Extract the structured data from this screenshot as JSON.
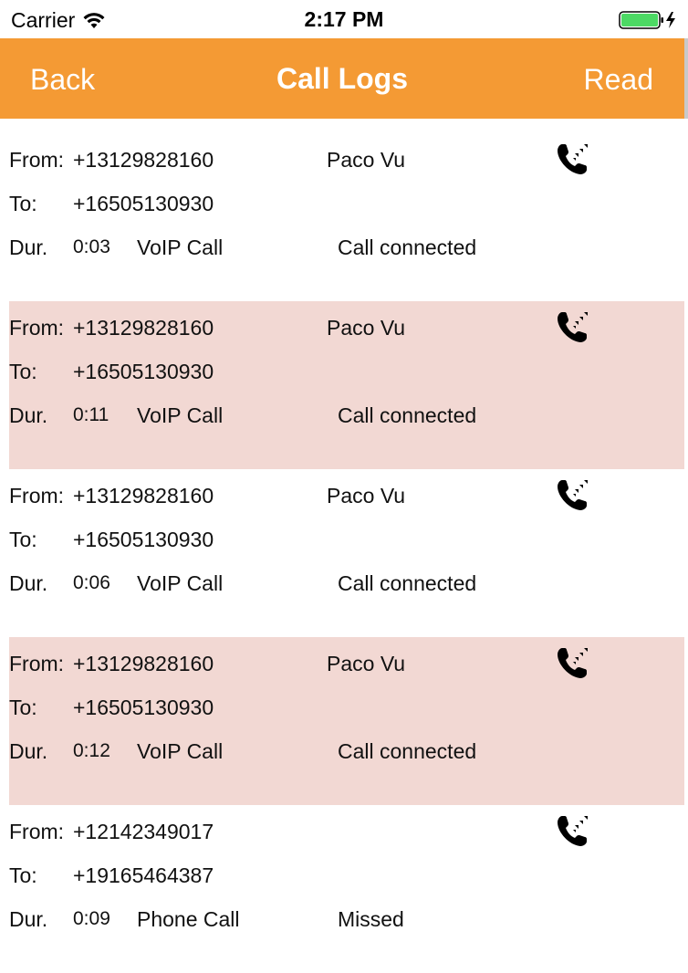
{
  "status_bar": {
    "carrier": "Carrier",
    "time": "2:17 PM",
    "wifi_icon": "wifi-icon",
    "battery_icon": "battery-charging-icon",
    "battery_color": "#4cd964"
  },
  "nav": {
    "back_label": "Back",
    "title": "Call Logs",
    "read_label": "Read",
    "bar_color": "#f49a34"
  },
  "labels": {
    "from": "From:",
    "to": "To:",
    "dur": "Dur."
  },
  "shaded_row_color": "#f2d8d3",
  "logs": [
    {
      "from": "+13129828160",
      "to": "+16505130930",
      "name": "Paco Vu",
      "duration": "0:03",
      "type": "VoIP Call",
      "status": "Call connected",
      "icon": "incoming-call-icon"
    },
    {
      "from": "+13129828160",
      "to": "+16505130930",
      "name": "Paco Vu",
      "duration": "0:11",
      "type": "VoIP Call",
      "status": "Call connected",
      "icon": "incoming-call-icon"
    },
    {
      "from": "+13129828160",
      "to": "+16505130930",
      "name": "Paco Vu",
      "duration": "0:06",
      "type": "VoIP Call",
      "status": "Call connected",
      "icon": "incoming-call-icon"
    },
    {
      "from": "+13129828160",
      "to": "+16505130930",
      "name": "Paco Vu",
      "duration": "0:12",
      "type": "VoIP Call",
      "status": "Call connected",
      "icon": "incoming-call-icon"
    },
    {
      "from": "+12142349017",
      "to": "+19165464387",
      "name": "",
      "duration": "0:09",
      "type": "Phone Call",
      "status": "Missed",
      "icon": "incoming-call-icon"
    }
  ]
}
